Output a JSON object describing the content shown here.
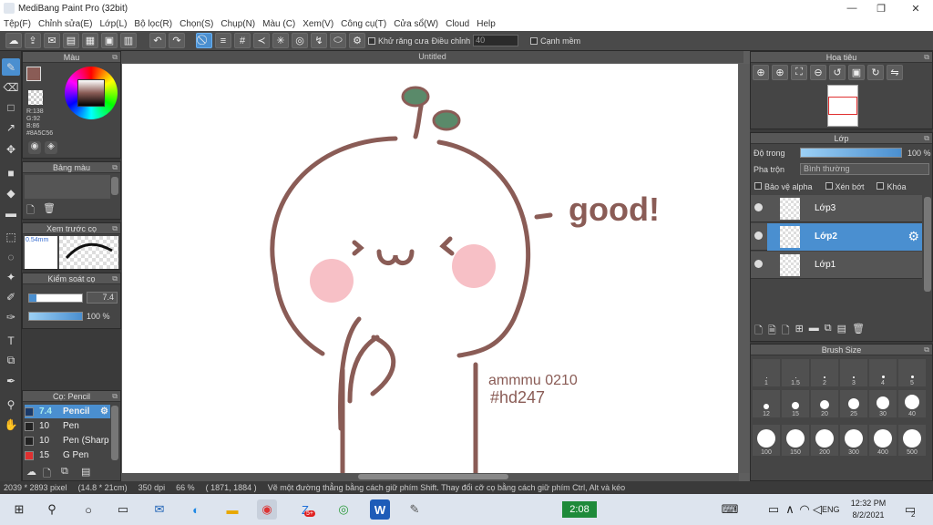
{
  "window": {
    "title": "MediBang Paint Pro (32bit)",
    "minimize": "—",
    "restore": "❐",
    "close": "✕"
  },
  "menu": [
    "Tệp(F)",
    "Chỉnh sửa(E)",
    "Lớp(L)",
    "Bộ lọc(R)",
    "Chọn(S)",
    "Chụp(N)",
    "Màu (C)",
    "Xem(V)",
    "Công cụ(T)",
    "Cửa sổ(W)",
    "Cloud",
    "Help"
  ],
  "toolbar": {
    "antialias_label": "Khử răng cưa",
    "adjust_label": "Điều chỉnh",
    "adjust_value": "40",
    "edge_label": "Cạnh mềm"
  },
  "color_panel": {
    "title": "Màu",
    "r": "R:138",
    "g": "G:92",
    "b": "B:86",
    "hex": "#8A5C56",
    "primary_color": "#8A5C56"
  },
  "palette_panel": {
    "title": "Bảng màu"
  },
  "brush_preview_panel": {
    "title": "Xem trước cọ",
    "size": "0.54mm"
  },
  "brush_control_panel": {
    "title": "Kiểm soát cọ",
    "size_value": "7.4",
    "opacity_value": "100 %"
  },
  "brush_panel": {
    "title": "Cọ: Pencil",
    "items": [
      {
        "size": "7.4",
        "name": "Pencil",
        "color": "#1a3a6a"
      },
      {
        "size": "10",
        "name": "Pen",
        "color": "#222"
      },
      {
        "size": "10",
        "name": "Pen (Sharp",
        "color": "#222"
      },
      {
        "size": "15",
        "name": "G Pen",
        "color": "#e03030"
      }
    ]
  },
  "document": {
    "tab": "Untitled",
    "annotation_good": "good!",
    "signature": "ammmu 0210",
    "hashtag": "#hd247"
  },
  "navigator_panel": {
    "title": "Hoa tiêu"
  },
  "layer_panel": {
    "title": "Lớp",
    "opacity_label": "Độ trong",
    "opacity_value": "100 %",
    "blend_label": "Pha trộn",
    "blend_value": "Bình thường",
    "protect_alpha": "Bảo vệ alpha",
    "clip": "Xén bớt",
    "lock": "Khóa",
    "layers": [
      {
        "name": "Lớp3",
        "selected": false
      },
      {
        "name": "Lớp2",
        "selected": true
      },
      {
        "name": "Lớp1",
        "selected": false
      }
    ]
  },
  "brush_size_panel": {
    "title": "Brush Size",
    "sizes": [
      "1",
      "1.5",
      "2",
      "3",
      "4",
      "5",
      "12",
      "15",
      "20",
      "25",
      "30",
      "40",
      "100",
      "150",
      "200",
      "300",
      "400",
      "500"
    ]
  },
  "status": {
    "dimensions": "2039 * 2893 pixel",
    "physical": "(14.8 * 21cm)",
    "dpi": "350 dpi",
    "zoom": "66 %",
    "coords": "( 1871, 1884 )",
    "hint": "Vẽ một đường thẳng bằng cách giữ phím Shift. Thay đổi cỡ cọ bằng cách giữ phím Ctrl, Alt và kéo"
  },
  "taskbar": {
    "timer": "2:08",
    "lang": "ENG",
    "time": "12:32 PM",
    "date": "8/2/2021",
    "notif_count": "2",
    "zalo_badge": "5+"
  }
}
